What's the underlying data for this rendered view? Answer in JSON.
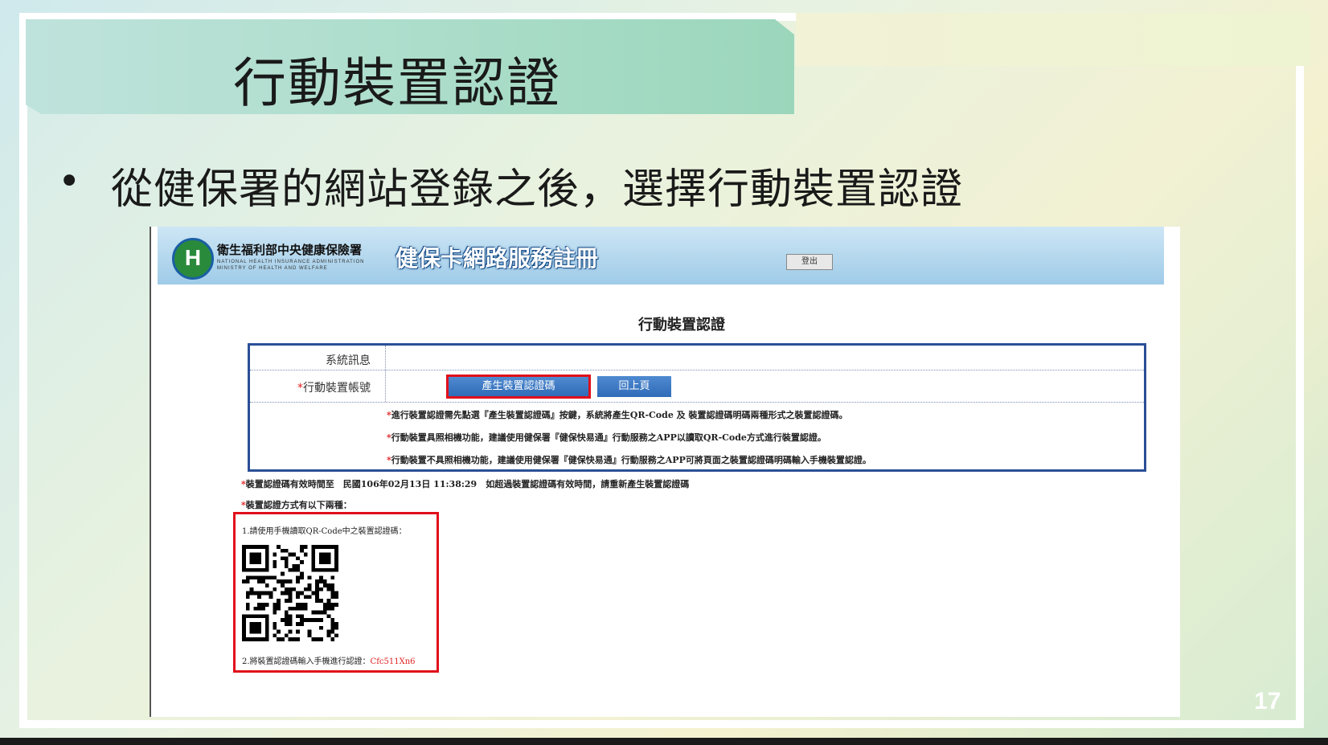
{
  "slide": {
    "title": "行動裝置認證",
    "bullet_symbol": "•",
    "bullet_text": "從健保署的網站登錄之後，選擇行動裝置認證",
    "page_number": "17"
  },
  "web": {
    "logo_glyph": "H",
    "org_name": "衛生福利部中央健康保險署",
    "org_name_en": "NATIONAL HEALTH INSURANCE ADMINISTRATION MINISTRY OF HEALTH AND WELFARE",
    "site_title": "健保卡網路服務註冊",
    "logout_label": "登出",
    "page_heading": "行動裝置認證",
    "form": {
      "system_message_label": "系統訊息",
      "device_account_star": "*",
      "device_account_label": "行動裝置帳號",
      "generate_button": "產生裝置認證碼",
      "back_button": "回上頁",
      "notes": [
        "進行裝置認證需先點選『產生裝置認證碼』按鍵，系統將產生QR-Code 及 裝置認證碼明碼兩種形式之裝置認證碼。",
        "行動裝置具照相機功能，建議使用健保署『健保快易通』行動服務之APP以讀取QR-Code方式進行裝置認證。",
        "行動裝置不具照相機功能，建議使用健保署『健保快易通』行動服務之APP可將頁面之裝置認證碼明碼輸入手機裝置認證。"
      ]
    },
    "info_lines": [
      "裝置認證碼有效時間至　民國106年02月13日 11:38:29　如超過裝置認證碼有效時間，請重新產生裝置認證碼",
      "裝置認證方式有以下兩種："
    ],
    "qr": {
      "line1": "1.請使用手機讀取QR-Code中之裝置認證碼：",
      "line2_prefix": "2.將裝置認證碼輸入手機進行認證：",
      "line2_code": "Cfc511Xn6"
    }
  }
}
